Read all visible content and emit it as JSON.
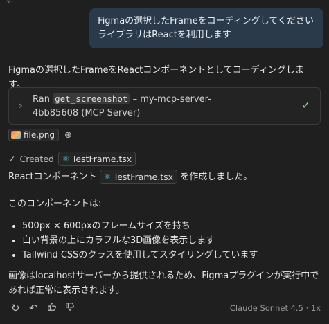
{
  "user_message": {
    "line1": "Figmaの選択したFrameをコーディングしてください",
    "line2": "ライブラリはReactを利用します"
  },
  "assistant": {
    "intro": "Figmaの選択したFrameをReactコンポーネントとしてコーディングします。",
    "tool": {
      "ran_label": "Ran",
      "command": "get_screenshot",
      "sep_source": "– my-mcp-server-",
      "source_line2": "4bb85608 (MCP Server)",
      "status_icon": "check-icon"
    },
    "attachment": {
      "file_name": "file.png",
      "add_icon": "add-context-icon"
    },
    "created": {
      "label": "Created",
      "file_name": "TestFrame.tsx"
    },
    "sentence": {
      "before": "Reactコンポーネント",
      "file": "TestFrame.tsx",
      "after": "を作成しました。"
    },
    "list_intro": "このコンポーネントは:",
    "bullets": [
      "500px × 600pxのフレームサイズを持ち",
      "白い背景の上にカラフルな3D画像を表示します",
      "Tailwind CSSのクラスを使用してスタイリングしています"
    ],
    "closing": "画像はlocalhostサーバーから提供されるため、Figmaプラグインが実行中であれば正常に表示されます。"
  },
  "footer": {
    "model": "Claude Sonnet 4.5 · 1x",
    "icons": [
      "retry-icon",
      "undo-icon",
      "thumbs-up-icon",
      "thumbs-down-icon"
    ]
  },
  "colors": {
    "background": "#1f1f1f",
    "user_bubble": "#2b3a4a",
    "check": "#9bd39b",
    "react": "#61dafb"
  }
}
